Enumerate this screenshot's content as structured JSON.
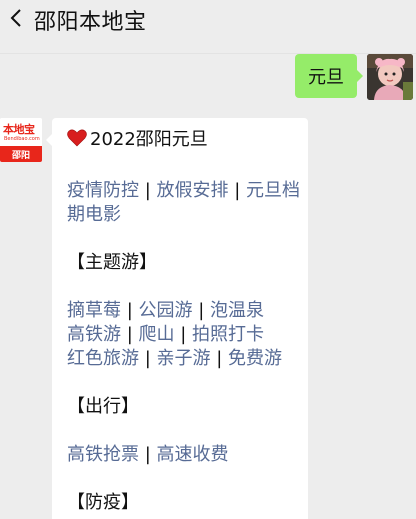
{
  "header": {
    "title": "邵阳本地宝"
  },
  "user_message": {
    "text": "元旦"
  },
  "bot_avatar": {
    "brand": "本地宝",
    "brand_sub": "Bendibao.com",
    "city": "邵阳"
  },
  "reply": {
    "heading": "2022邵阳元旦",
    "group1": {
      "links": [
        "疫情防控",
        "放假安排",
        "元旦档",
        "期电影"
      ]
    },
    "section_theme": "【主题游】",
    "group2": {
      "row1": [
        "摘草莓",
        "公园游",
        "泡温泉"
      ],
      "row2": [
        "高铁游",
        "爬山",
        "拍照打卡"
      ],
      "row3": [
        "红色旅游",
        "亲子游",
        "免费游"
      ]
    },
    "section_travel": "【出行】",
    "group3": {
      "links": [
        "高铁抢票",
        "高速收费"
      ]
    },
    "section_prevention": "【防疫】"
  },
  "separator": " | ",
  "colors": {
    "link": "#576b95",
    "bubble_green": "#95ec69",
    "background": "#ededed",
    "brand_red": "#e8261b"
  },
  "icons": {
    "back": "chevron-left-icon",
    "heart": "red-heart-icon"
  }
}
